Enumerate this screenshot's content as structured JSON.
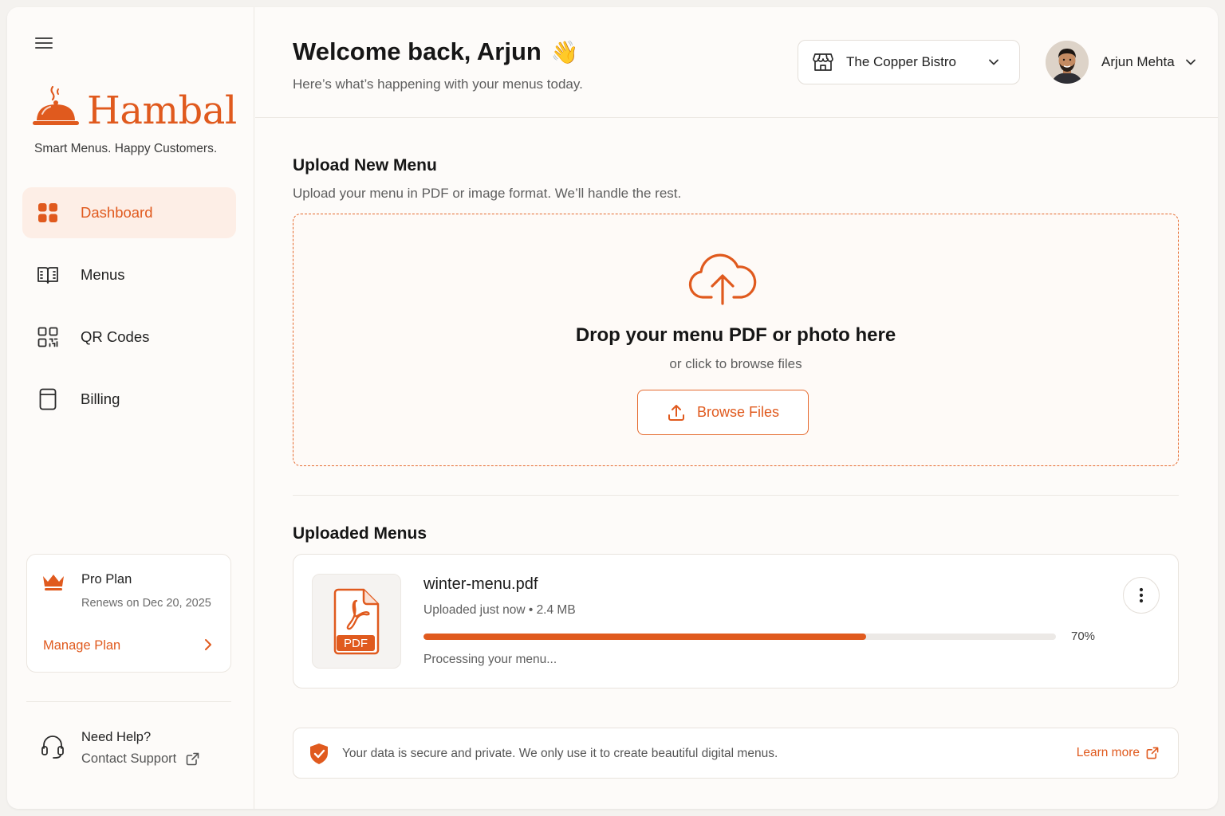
{
  "brand": {
    "name": "Hambal",
    "tagline": "Smart Menus. Happy Customers.",
    "accent_color": "#e05a1e"
  },
  "sidebar": {
    "items": [
      {
        "label": "Dashboard",
        "icon": "grid-icon",
        "active": true
      },
      {
        "label": "Menus",
        "icon": "book-icon",
        "active": false
      },
      {
        "label": "QR Codes",
        "icon": "qr-code-icon",
        "active": false
      },
      {
        "label": "Billing",
        "icon": "billing-icon",
        "active": false
      }
    ],
    "plan": {
      "title": "Pro Plan",
      "renews": "Renews on Dec 20, 2025",
      "manage_label": "Manage Plan"
    },
    "help": {
      "title": "Need Help?",
      "link_label": "Contact Support"
    }
  },
  "header": {
    "welcome": "Welcome back, Arjun",
    "wave_emoji": "👋",
    "subtitle": "Here’s what’s happening with your menus today.",
    "store_name": "The Copper Bistro",
    "user_name": "Arjun Mehta"
  },
  "upload": {
    "title": "Upload New Menu",
    "subtitle": "Upload your menu in PDF or image format. We’ll handle the rest.",
    "drop_title": "Drop your menu PDF or photo here",
    "drop_sub": "or click to browse files",
    "browse_label": "Browse Files"
  },
  "uploaded": {
    "title": "Uploaded Menus",
    "files": [
      {
        "name": "winter-menu.pdf",
        "meta": "Uploaded just now • 2.4 MB",
        "thumb_label": "PDF",
        "progress": 70,
        "progress_label": "70%",
        "status": "Processing your menu..."
      }
    ]
  },
  "security": {
    "text": "Your data is secure and private. We only use it to create beautiful digital menus.",
    "learn_more": "Learn more"
  }
}
